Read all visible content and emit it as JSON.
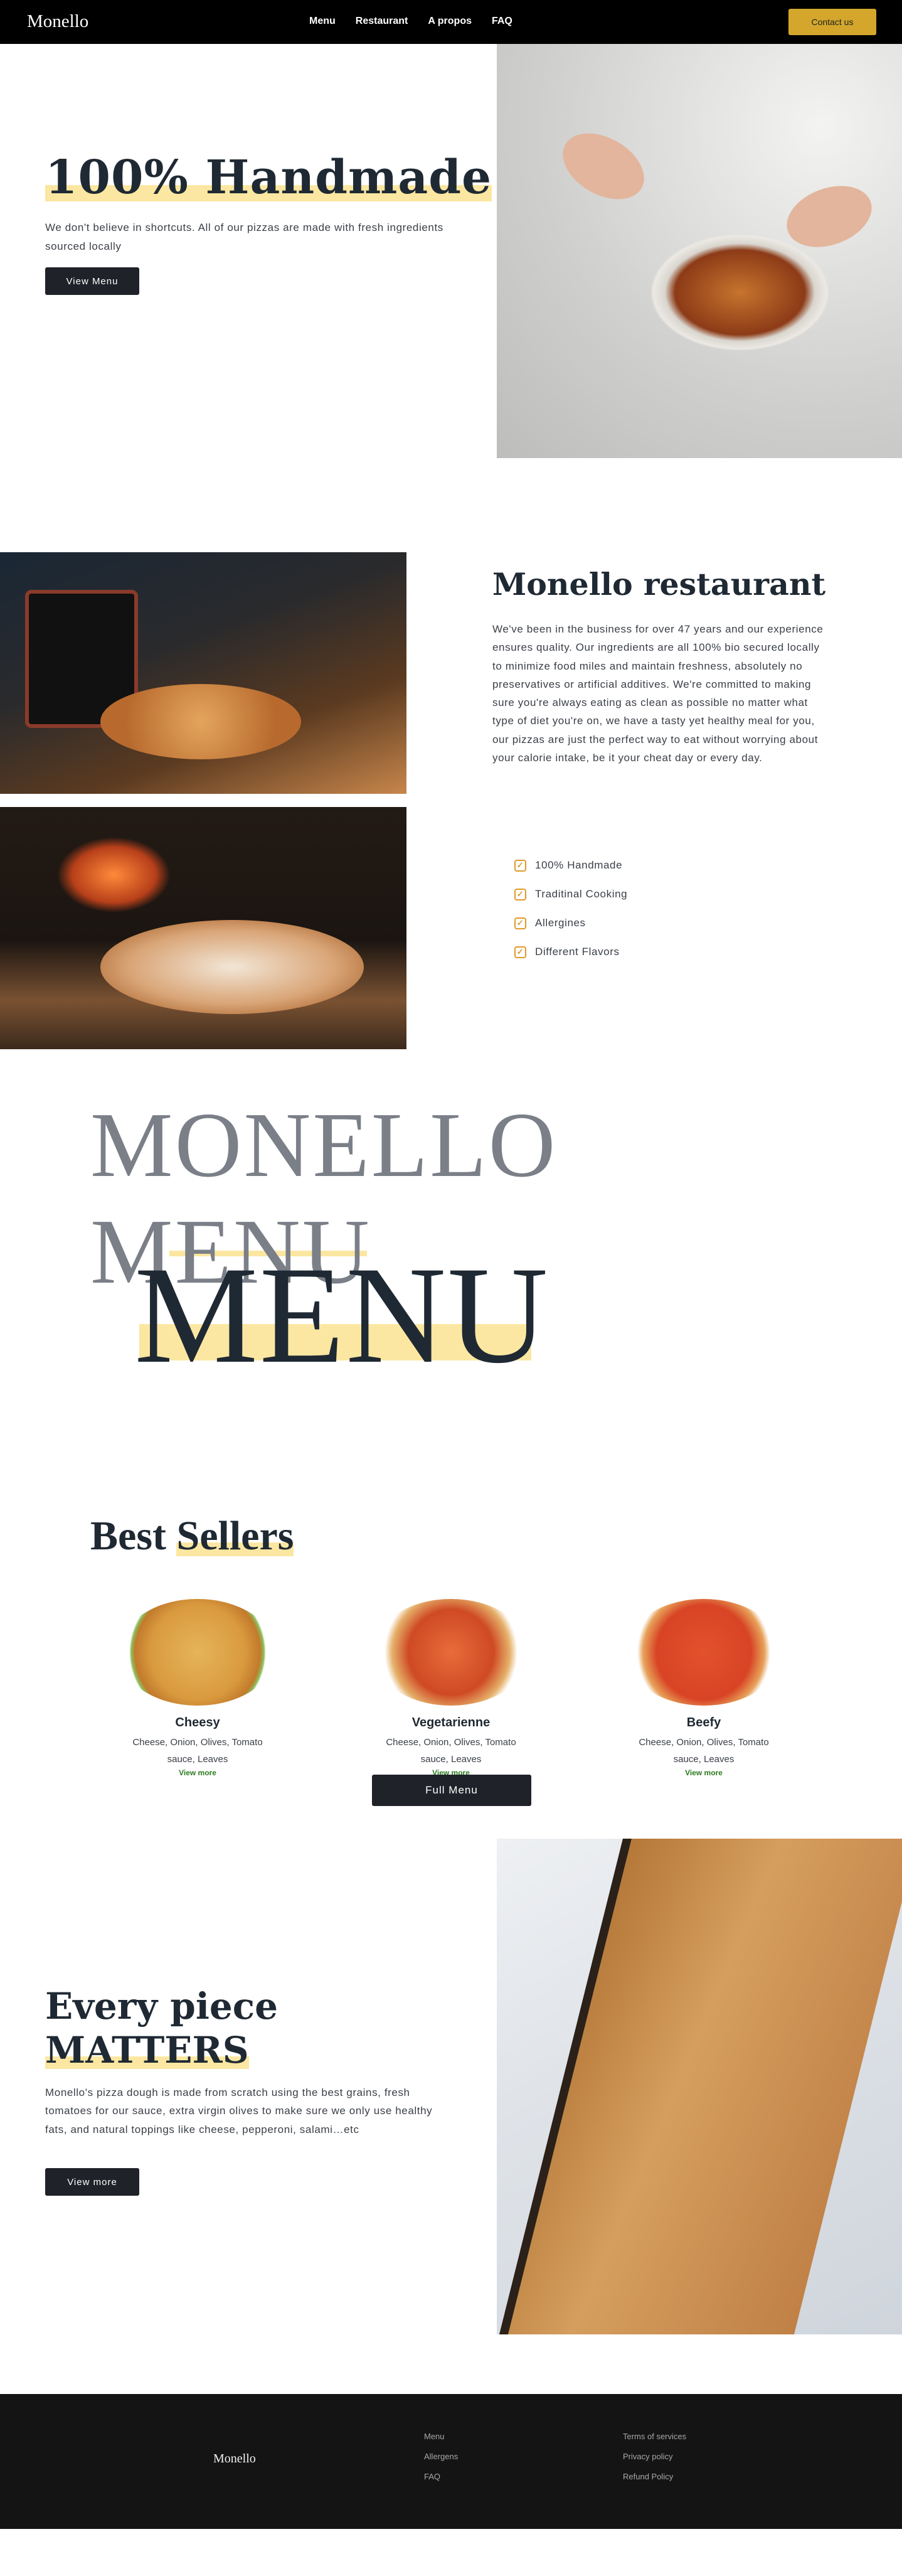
{
  "nav": {
    "logo": "Monello",
    "links": [
      "Menu",
      "Restaurant",
      "A propos",
      "FAQ"
    ],
    "contact_label": "Contact us"
  },
  "hero": {
    "title": "100% Handmade",
    "text": "We don't believe in shortcuts. All of our pizzas are made with fresh ingredients sourced locally",
    "button_label": "View Menu"
  },
  "about": {
    "title": "Monello restaurant",
    "text": "We've been in the business for over 47 years and our experience ensures quality. Our ingredients are all 100% bio secured locally to minimize food miles and maintain freshness, absolutely no preservatives or artificial additives. We're committed to making sure you're always eating as clean as possible no matter what type of diet you're on, we have a tasty yet healthy meal for you, our pizzas are just the perfect way to eat without worrying about your calorie intake, be it your cheat day or every day.",
    "features": [
      "100% Handmade",
      "Traditinal Cooking",
      "Allergines",
      "Different Flavors"
    ]
  },
  "bigtext": {
    "line1": "MONELLO",
    "line2": "MENU",
    "line3": "MENU"
  },
  "sellers": {
    "title_word1": "Best",
    "title_word2": "Sellers",
    "items": [
      {
        "name": "Cheesy",
        "desc": "Cheese, Onion, Olives, Tomato sauce, Leaves",
        "link": "View more"
      },
      {
        "name": "Vegetarienne",
        "desc": "Cheese, Onion, Olives, Tomato sauce, Leaves",
        "link": "View more"
      },
      {
        "name": "Beefy",
        "desc": "Cheese, Onion, Olives, Tomato sauce, Leaves",
        "link": "View more"
      }
    ],
    "full_menu_label": "Full Menu"
  },
  "piece": {
    "title_line1": "Every piece",
    "title_line2": "MATTERS",
    "text": "Monello's pizza dough is made from scratch using the best grains, fresh tomatoes for our sauce, extra virgin olives to make sure we only use healthy fats, and natural toppings like cheese, pepperoni, salami…etc",
    "button_label": "View more"
  },
  "footer": {
    "logo": "Monello",
    "col1": [
      "Menu",
      "Allergens",
      "FAQ"
    ],
    "col2": [
      "Terms of services",
      "Privacy policy",
      "Refund Policy"
    ]
  },
  "colors": {
    "accent": "#d4a72c",
    "highlight": "#fbe7a1",
    "dark": "#1f2933",
    "check": "#e09a2b",
    "link_green": "#2b7a1e"
  }
}
